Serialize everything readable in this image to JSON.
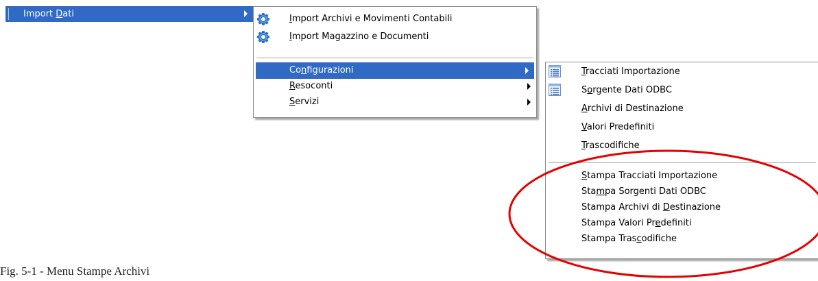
{
  "parent_item": {
    "pre": "Import ",
    "ul": "D",
    "post": "ati"
  },
  "menu1": {
    "items": [
      {
        "pre": "",
        "ul": "I",
        "post": "mport Archivi e Movimenti Contabili",
        "icon": "gear-icon"
      },
      {
        "pre": "",
        "ul": "I",
        "post": "mport Magazzino e Documenti",
        "icon": "gear-icon"
      }
    ],
    "sub": [
      {
        "pre": "Co",
        "ul": "n",
        "post": "figurazioni"
      },
      {
        "pre": "",
        "ul": "R",
        "post": "esoconti"
      },
      {
        "pre": "",
        "ul": "S",
        "post": "ervizi"
      }
    ]
  },
  "menu2": {
    "items": [
      {
        "pre": "",
        "ul": "T",
        "post": "racciati Importazione",
        "icon": "list-icon"
      },
      {
        "pre": "S",
        "ul": "o",
        "post": "rgente Dati ODBC",
        "icon": "list-icon"
      },
      {
        "pre": "",
        "ul": "A",
        "post": "rchivi di Destinazione"
      },
      {
        "pre": "",
        "ul": "V",
        "post": "alori Predefiniti"
      },
      {
        "pre": "",
        "ul": "T",
        "post": "rascodifiche"
      }
    ],
    "prints": [
      {
        "pre": "",
        "ul": "S",
        "post": "tampa Tracciati Importazione"
      },
      {
        "pre": "Sta",
        "ul": "m",
        "post": "pa Sorgenti Dati ODBC"
      },
      {
        "pre": "Stampa Archivi di ",
        "ul": "D",
        "post": "estinazione"
      },
      {
        "pre": "Stampa Valori Pr",
        "ul": "e",
        "post": "definiti"
      },
      {
        "pre": "Stampa Tras",
        "ul": "c",
        "post": "odifiche"
      }
    ]
  },
  "caption": "Fig.  5-1 - Menu Stampe Archivi",
  "colors": {
    "highlight": "#316ac5",
    "annotation": "#e60000"
  }
}
